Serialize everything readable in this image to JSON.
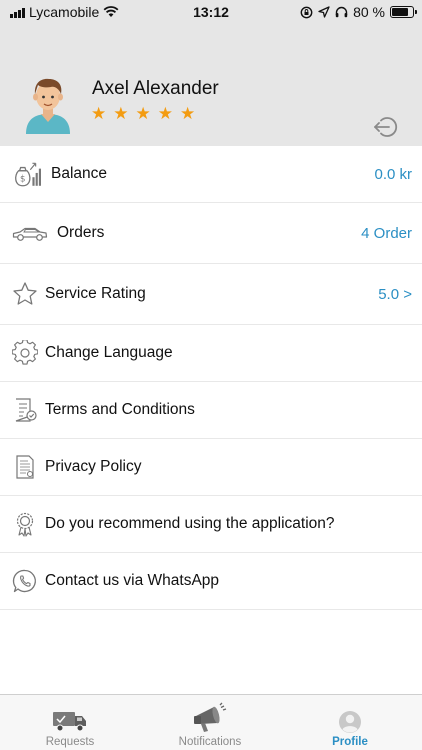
{
  "status_bar": {
    "carrier": "Lycamobile",
    "time": "13:12",
    "battery": "80 %",
    "battery_level": 0.8
  },
  "profile": {
    "name": "Axel Alexander",
    "rating_stars": 5,
    "star_color": "#f39c12",
    "icons": {
      "avatar": "avatar-icon",
      "logout": "logout-icon"
    }
  },
  "menu": {
    "balance": {
      "label": "Balance",
      "value": "0.0 kr",
      "icon": "money-bag-icon"
    },
    "orders": {
      "label": "Orders",
      "value": "4 Order",
      "icon": "car-icon"
    },
    "service_rating": {
      "label": "Service Rating",
      "value": "5.0 >",
      "icon": "star-outline-icon"
    },
    "change_language": {
      "label": "Change Language",
      "icon": "gear-icon"
    },
    "terms": {
      "label": "Terms and Conditions",
      "icon": "document-check-icon"
    },
    "privacy": {
      "label": "Privacy Policy",
      "icon": "document-icon"
    },
    "recommend": {
      "label": "Do you recommend using the application?",
      "icon": "award-badge-icon"
    },
    "whatsapp": {
      "label": "Contact us via WhatsApp",
      "icon": "whatsapp-icon"
    }
  },
  "tabs": {
    "requests": {
      "label": "Requests",
      "icon": "truck-icon"
    },
    "notifications": {
      "label": "Notifications",
      "icon": "megaphone-icon"
    },
    "profile": {
      "label": "Profile",
      "icon": "user-icon",
      "active": true
    }
  },
  "colors": {
    "accent": "#2b8fc4",
    "header_bg": "#e6e6e6",
    "star": "#f39c12"
  }
}
